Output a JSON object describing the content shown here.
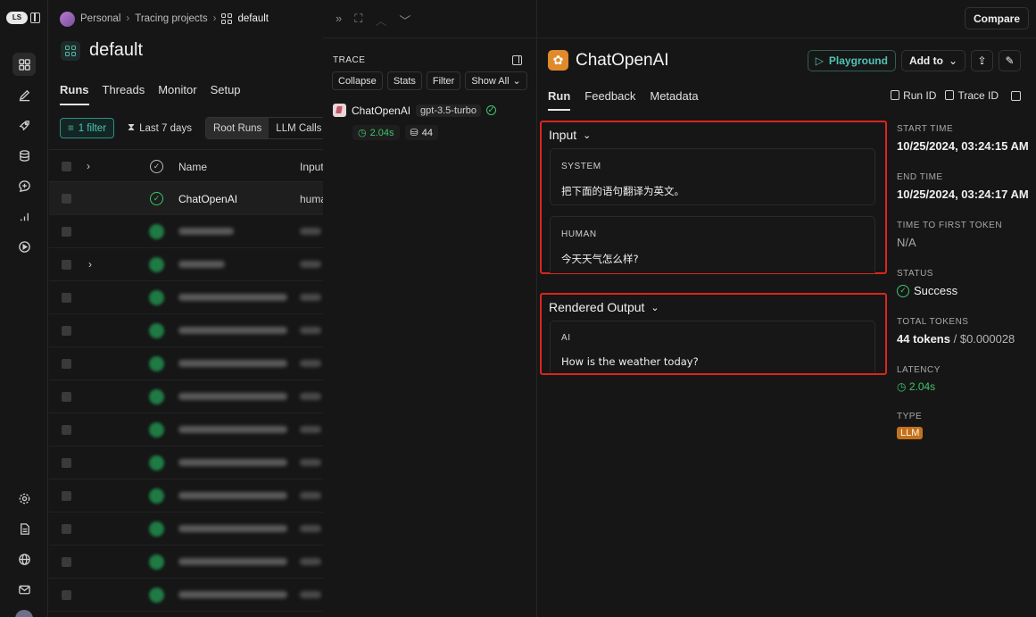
{
  "rail": {
    "logo": "LS",
    "icons": [
      "grid-icon",
      "pen-icon",
      "rocket-icon",
      "database-icon",
      "chat-plus-icon",
      "bar-chart-icon",
      "play-circle-icon",
      "gear-icon",
      "document-icon",
      "globe-icon",
      "mail-icon"
    ]
  },
  "breadcrumb": {
    "workspace": "Personal",
    "section": "Tracing projects",
    "project": "default"
  },
  "project": {
    "title": "default",
    "tabs": [
      "Runs",
      "Threads",
      "Monitor",
      "Setup"
    ],
    "active_tab": "Runs",
    "filters": {
      "filter": "1 filter",
      "range": "Last 7 days",
      "seg_active": "Root Runs",
      "seg_other": "LLM Calls"
    },
    "columns": {
      "name": "Name",
      "input": "Input"
    },
    "first_row": {
      "name": "ChatOpenAI",
      "input": "human"
    }
  },
  "trace": {
    "label": "TRACE",
    "buttons": {
      "collapse": "Collapse",
      "stats": "Stats",
      "filter": "Filter",
      "show": "Show All"
    },
    "node": {
      "name": "ChatOpenAI",
      "model": "gpt-3.5-turbo",
      "latency": "2.04s",
      "tokens": "44"
    }
  },
  "run": {
    "compare": "Compare",
    "title": "ChatOpenAI",
    "actions": {
      "playground": "Playground",
      "add_to": "Add to"
    },
    "tabs": [
      "Run",
      "Feedback",
      "Metadata"
    ],
    "active_tab": "Run",
    "ids": {
      "run_id": "Run ID",
      "trace_id": "Trace ID"
    },
    "input": {
      "title": "Input",
      "messages": [
        {
          "role": "SYSTEM",
          "text": "把下面的语句翻译为英文。"
        },
        {
          "role": "HUMAN",
          "text": "今天天气怎么样?"
        }
      ]
    },
    "output": {
      "title": "Rendered Output",
      "messages": [
        {
          "role": "AI",
          "text": "How is the weather today?"
        }
      ]
    },
    "meta": {
      "start_label": "START TIME",
      "start_value": "10/25/2024, 03:24:15 AM",
      "end_label": "END TIME",
      "end_value": "10/25/2024, 03:24:17 AM",
      "ttft_label": "TIME TO FIRST TOKEN",
      "ttft_value": "N/A",
      "status_label": "STATUS",
      "status_value": "Success",
      "tokens_label": "TOTAL TOKENS",
      "tokens_value": "44 tokens",
      "cost_value": "/ $0.000028",
      "latency_label": "LATENCY",
      "latency_value": "2.04s",
      "type_label": "TYPE",
      "type_value": "LLM"
    }
  },
  "colors": {
    "accent": "#4fc3b5",
    "success": "#3ec46d",
    "highlight": "#d9261c",
    "llm_badge": "#c4711c"
  }
}
